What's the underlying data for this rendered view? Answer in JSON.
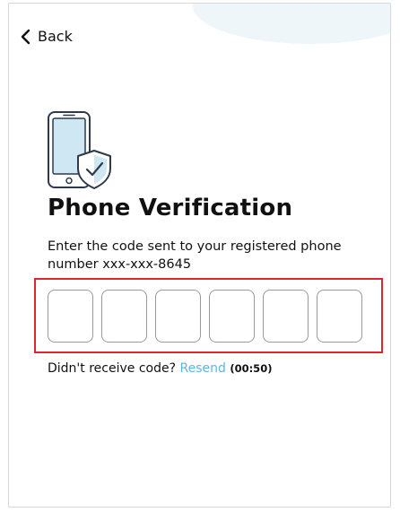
{
  "nav": {
    "back_label": "Back"
  },
  "verification": {
    "title": "Phone Verification",
    "instructions": "Enter the code sent to your registered phone number xxx-xxx-8645",
    "code_digits": [
      "",
      "",
      "",
      "",
      "",
      ""
    ]
  },
  "resend": {
    "prompt": "Didn't receive code?",
    "link_label": "Resend",
    "timer": "(00:50)"
  },
  "icons": {
    "back": "chevron-left-icon",
    "illustration": "phone-shield-check-icon"
  },
  "colors": {
    "accent": "#5cb8de",
    "highlight": "#e0262b",
    "text": "#111111"
  }
}
